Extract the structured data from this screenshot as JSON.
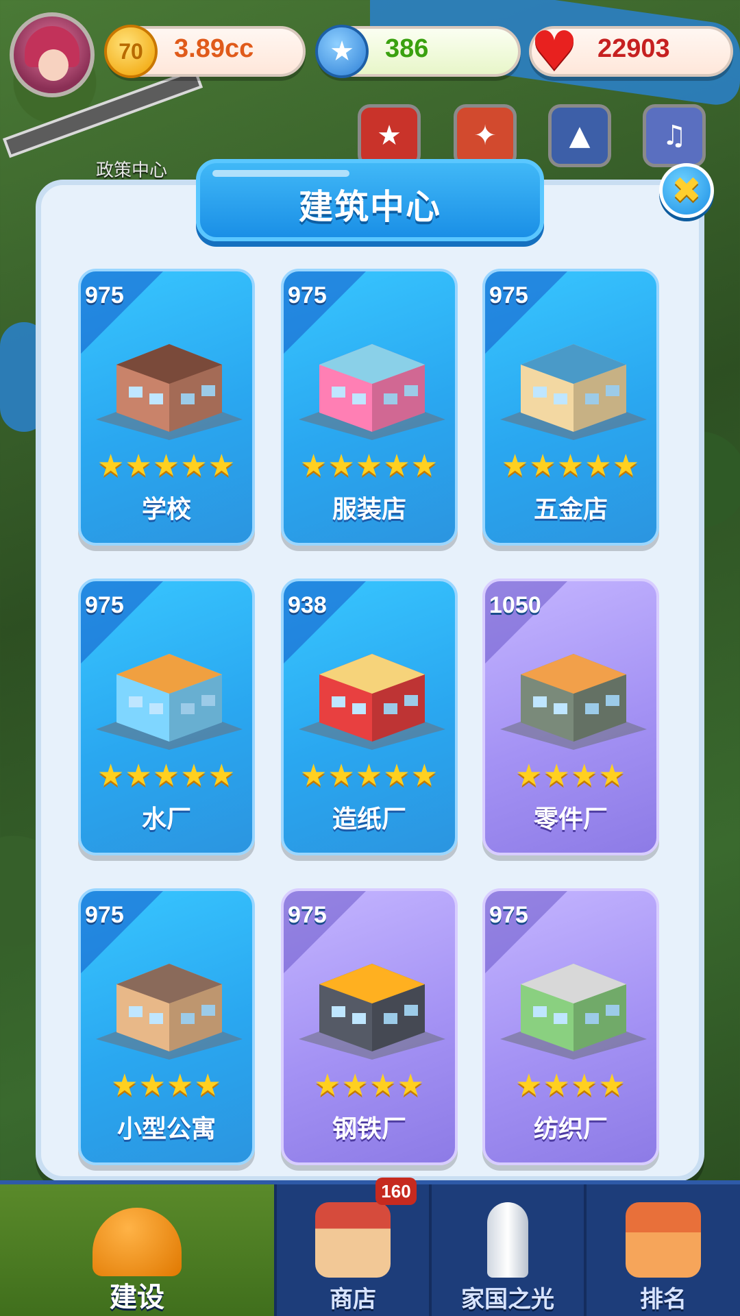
{
  "top_bar": {
    "gold": {
      "value": "3.89cc",
      "icon": "gold-coin-icon",
      "color": "#e05a1a",
      "coin_label": "70"
    },
    "blue_star": {
      "value": "386",
      "icon": "blue-star-icon",
      "color": "#3aa10f"
    },
    "hearts": {
      "value": "22903",
      "icon": "heart-icon",
      "color": "#c62020"
    }
  },
  "map_label": "政策中心",
  "panel": {
    "title": "建筑中心",
    "close_icon": "close-x-icon"
  },
  "buildings": [
    {
      "name": "学校",
      "price": "975",
      "stars": "★★★★★",
      "star_count": 5,
      "theme": "blue"
    },
    {
      "name": "服装店",
      "price": "975",
      "stars": "★★★★★",
      "star_count": 5,
      "theme": "blue"
    },
    {
      "name": "五金店",
      "price": "975",
      "stars": "★★★★★",
      "star_count": 5,
      "theme": "blue"
    },
    {
      "name": "水厂",
      "price": "975",
      "stars": "★★★★★",
      "star_count": 5,
      "theme": "blue"
    },
    {
      "name": "造纸厂",
      "price": "938",
      "stars": "★★★★★",
      "star_count": 5,
      "theme": "blue"
    },
    {
      "name": "零件厂",
      "price": "1050",
      "stars": "★★★★",
      "star_count": 4,
      "theme": "purple"
    },
    {
      "name": "小型公寓",
      "price": "975",
      "stars": "★★★★",
      "star_count": 4,
      "theme": "blue"
    },
    {
      "name": "钢铁厂",
      "price": "975",
      "stars": "★★★★",
      "star_count": 4,
      "theme": "purple"
    },
    {
      "name": "纺织厂",
      "price": "975",
      "stars": "★★★★",
      "star_count": 4,
      "theme": "purple"
    }
  ],
  "bottom_nav": {
    "items": [
      {
        "label": "建设",
        "icon": "hard-hat-icon",
        "active": true
      },
      {
        "label": "商店",
        "icon": "shop-building-icon",
        "active": false
      },
      {
        "label": "家国之光",
        "icon": "rocket-icon",
        "active": false
      },
      {
        "label": "排名",
        "icon": "podium-icon",
        "active": false
      }
    ],
    "shop_badge": "160"
  }
}
